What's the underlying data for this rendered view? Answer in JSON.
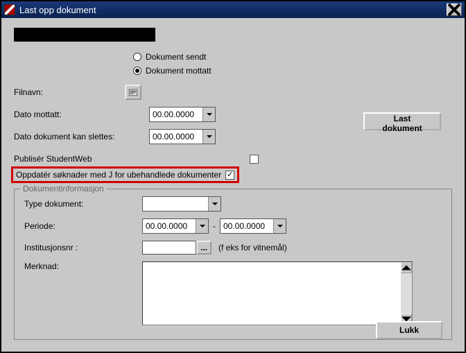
{
  "title": "Last opp dokument",
  "radios": {
    "sent": "Dokument sendt",
    "received": "Dokument mottatt"
  },
  "labels": {
    "filename": "Filnavn:",
    "date_received": "Dato mottatt:",
    "date_deletable": "Dato dokument kan slettes:",
    "publish_studentweb": "Publisér StudentWeb",
    "update_applications": "Oppdatér søknader med J for ubehandlede dokumenter",
    "doc_info": "Dokumentinformasjon",
    "doc_type": "Type dokument:",
    "period": "Periode:",
    "institution_nr": "Institusjonsnr :",
    "institution_hint": "(f eks for vitnemål)",
    "note": "Merknad:"
  },
  "values": {
    "date_received": "00.00.0000",
    "date_deletable": "00.00.0000",
    "period_from": "00.00.0000",
    "period_to": "00.00.0000",
    "doc_type": "",
    "institution_nr": "",
    "note": ""
  },
  "buttons": {
    "load_document": "Last dokument",
    "close": "Lukk",
    "ellipsis": "..."
  },
  "checkboxes": {
    "publish_studentweb": false,
    "update_applications": true
  }
}
